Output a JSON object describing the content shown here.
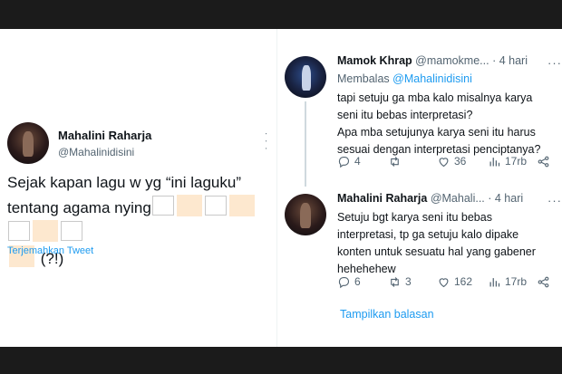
{
  "left_tweet": {
    "author_name": "Mahalini Raharja",
    "author_handle": "@Mahalinidisini",
    "text_line1": "Sejak kapan lagu w yg “ini laguku”",
    "text_line2_prefix": "tentang agama nying",
    "text_line3_suffix": "(?!)",
    "translate_link": "Terjemahkan Tweet",
    "more": "· · ·"
  },
  "reply1": {
    "author_name": "Mamok Khrap",
    "author_handle": "@mamokme...",
    "time": "· 4 hari",
    "replying_prefix": "Membalas",
    "replying_handle": "@Mahalinidisini",
    "lines": [
      "tapi setuju ga mba kalo misalnya karya",
      "seni itu bebas interpretasi?",
      "Apa mba setujunya karya seni itu harus",
      "sesuai dengan interpretasi penciptanya?"
    ],
    "replies": "4",
    "retweets": "",
    "likes": "36",
    "views": "17rb"
  },
  "reply2": {
    "author_name": "Mahalini Raharja",
    "author_handle": "@Mahali...",
    "time": "· 4 hari",
    "lines": [
      "Setuju bgt karya seni itu bebas",
      "interpretasi, tp ga setuju kalo dipake",
      "konten untuk sesuatu hal yang gabener",
      "hehehehew"
    ],
    "replies": "6",
    "retweets": "3",
    "likes": "162",
    "views": "17rb"
  },
  "show_replies": "Tampilkan balasan",
  "colors": {
    "text": "#0f1419",
    "muted": "#536471",
    "link": "#1d9bf0",
    "background": "#ffffff",
    "frame": "#1b1b1b"
  }
}
